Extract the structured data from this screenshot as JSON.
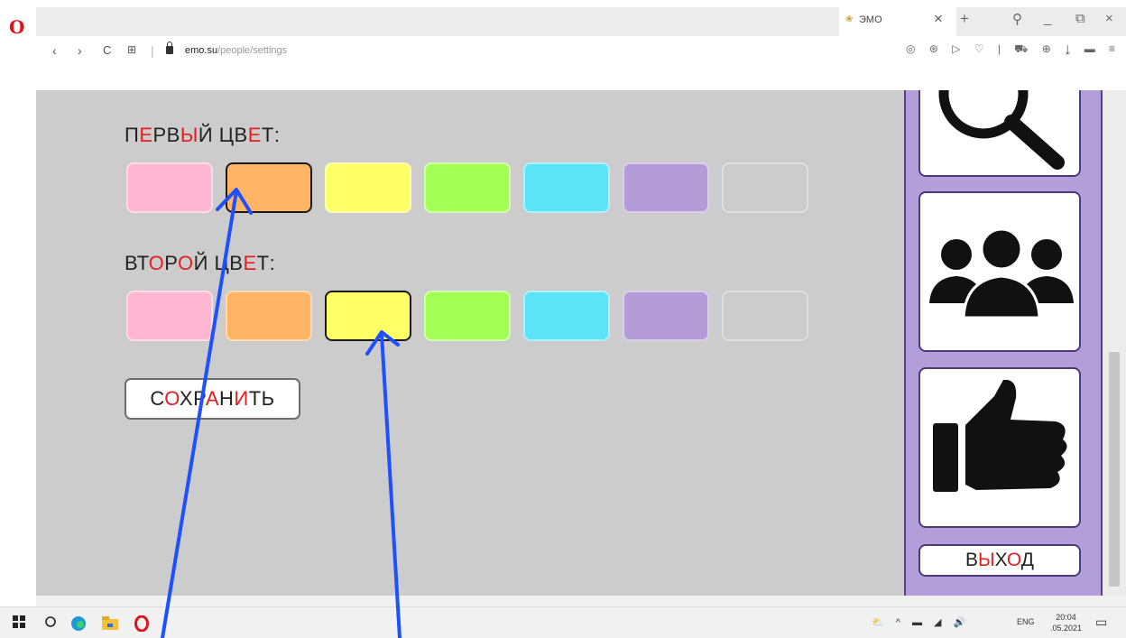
{
  "browser": {
    "logo": "O",
    "tab": {
      "favicon": "❀",
      "title": "ЭМО",
      "close": "×"
    },
    "new_tab": "+",
    "window_controls": [
      "⚲",
      "_",
      "⧉",
      "×"
    ],
    "nav": [
      "‹",
      "›",
      "C",
      "⊞",
      "|"
    ],
    "url_host": "emo.su",
    "url_path": "/people/settings",
    "toolbar_icons": "◎ ⊛ ▷ ♡ | ⛟ ⊕ ⤓ ▬ ≡"
  },
  "settings": {
    "first_color_label": [
      {
        "t": "П",
        "c": "black"
      },
      {
        "t": "Е",
        "c": "red"
      },
      {
        "t": "РВ",
        "c": "black"
      },
      {
        "t": "Ы",
        "c": "red"
      },
      {
        "t": "Й ЦВ",
        "c": "black"
      },
      {
        "t": "Е",
        "c": "red"
      },
      {
        "t": "Т:",
        "c": "black"
      }
    ],
    "second_color_label": [
      {
        "t": "ВТ",
        "c": "black"
      },
      {
        "t": "О",
        "c": "red"
      },
      {
        "t": "Р",
        "c": "black"
      },
      {
        "t": "О",
        "c": "red"
      },
      {
        "t": "Й ЦВ",
        "c": "black"
      },
      {
        "t": "Е",
        "c": "red"
      },
      {
        "t": "Т:",
        "c": "black"
      }
    ],
    "save_label": [
      {
        "t": "С",
        "c": "black"
      },
      {
        "t": "О",
        "c": "red"
      },
      {
        "t": "ХР",
        "c": "black"
      },
      {
        "t": "А",
        "c": "red"
      },
      {
        "t": "Н",
        "c": "black"
      },
      {
        "t": "И",
        "c": "red"
      },
      {
        "t": "ТЬ",
        "c": "black"
      }
    ],
    "palette": [
      "#ffb6d0",
      "#ffb565",
      "#ffff66",
      "#a3ff55",
      "#5ce3f6",
      "#b39cd8",
      "#cccccc"
    ],
    "first_selected_index": 1,
    "second_selected_index": 2
  },
  "panel": {
    "buttons": [
      "search-icon",
      "people-icon",
      "thumbs-up-icon"
    ],
    "exit_label": [
      {
        "t": "В",
        "c": "black"
      },
      {
        "t": "Ы",
        "c": "red"
      },
      {
        "t": "Х",
        "c": "black"
      },
      {
        "t": "О",
        "c": "red"
      },
      {
        "t": "Д",
        "c": "black"
      }
    ]
  },
  "taskbar": {
    "icons": [
      "windows-icon",
      "search-icon",
      "edge-icon",
      "explorer-icon",
      "opera-icon"
    ],
    "tray": "⛅ ^ ▬ ◢ 🔊",
    "lang": "ENG",
    "time": "20:04",
    "date": ".05.2021"
  },
  "colors": {
    "red_letter": "#e51e1e",
    "page_bg": "#cccccc",
    "panel_bg": "#b29ed9",
    "annotation": "#1f4fff"
  }
}
